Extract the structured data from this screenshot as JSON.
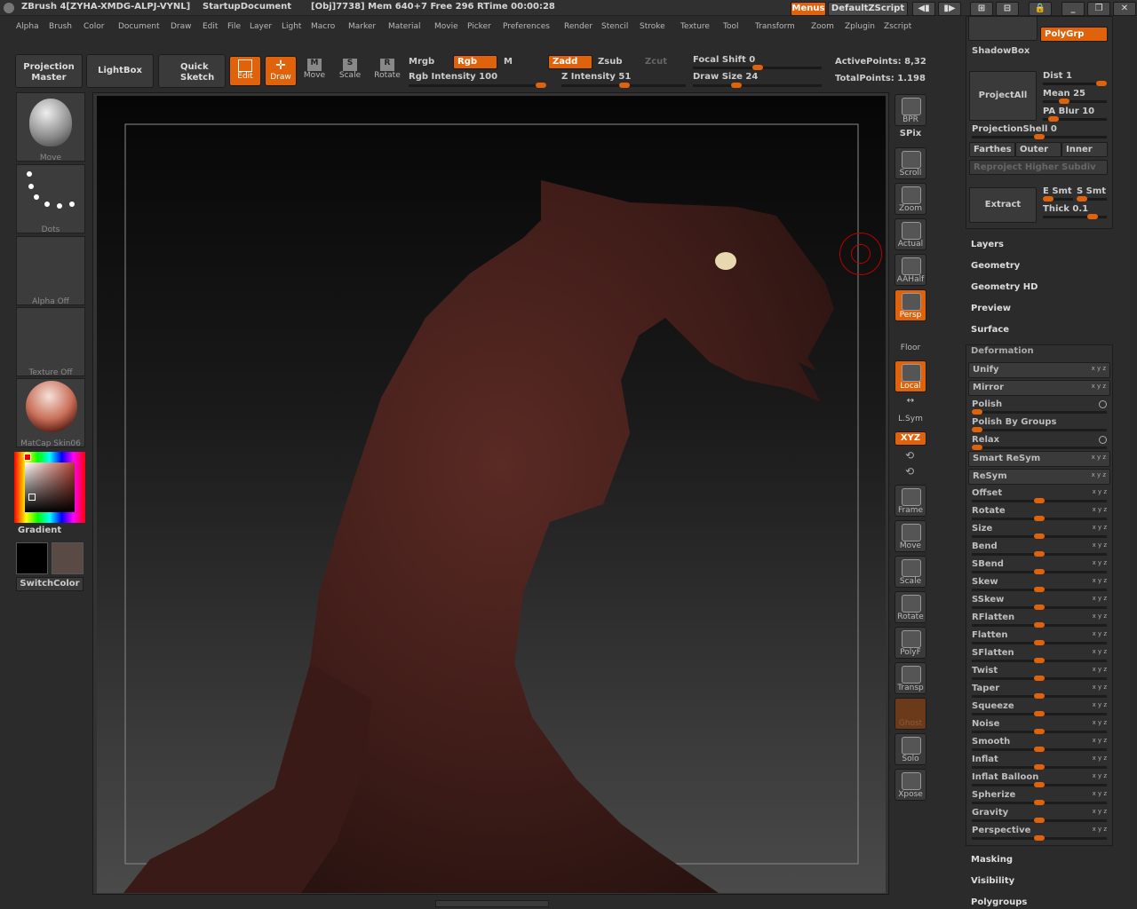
{
  "title": {
    "app": "ZBrush 4[ZYHA-XMDG-ALPJ-VYNL]",
    "document": "StartupDocument",
    "stats": "[Obj]7738] Mem 640+7  Free 296  RTime 00:00:28",
    "menus_btn": "Menus",
    "script_btn": "DefaultZScript"
  },
  "menubar": [
    "Alpha",
    "Brush",
    "Color",
    "Document",
    "Draw",
    "Edit",
    "File",
    "Layer",
    "Light",
    "Macro",
    "Marker",
    "Material",
    "Movie",
    "Picker",
    "Preferences",
    "Render",
    "Stencil",
    "Stroke",
    "Texture",
    "Tool",
    "Transform",
    "Zoom",
    "Zplugin",
    "Zscript"
  ],
  "toolbar": {
    "projection_master": [
      "Projection",
      "Master"
    ],
    "lightbox": "LightBox",
    "quick_sketch": [
      "Quick",
      "Sketch"
    ],
    "edit": "Edit",
    "draw": "Draw",
    "move": "Move",
    "scale": "Scale",
    "rotate": "Rotate",
    "mrgb": "Mrgb",
    "rgb": "Rgb",
    "m": "M",
    "zadd": "Zadd",
    "zsub": "Zsub",
    "zcut": "Zcut",
    "rgb_intensity": "Rgb Intensity 100",
    "z_intensity": "Z Intensity 51",
    "focal_shift": "Focal Shift 0",
    "draw_size": "Draw Size 24",
    "active_points": "ActivePoints: 8,32",
    "total_points": "TotalPoints: 1.198",
    "rgb_intensity_value": 100,
    "z_intensity_value": 51,
    "focal_shift_value": 0,
    "draw_size_value": 24
  },
  "left": {
    "brush": "Move",
    "stroke": "Dots",
    "alpha": "Alpha  Off",
    "texture": "Texture  Off",
    "material": "MatCap  Skin06",
    "gradient": "Gradient",
    "switch_color": "SwitchColor"
  },
  "shelf": [
    "BPR",
    "SPix",
    "Scroll",
    "Zoom",
    "Actual",
    "AAHalf",
    "Persp",
    "Floor",
    "Local",
    "L.Sym",
    "XYZ",
    "Frame",
    "Move",
    "Scale",
    "Rotate",
    "PolyF",
    "Transp",
    "Ghost",
    "Solo",
    "Xpose"
  ],
  "tool": {
    "polygrp": "PolyGrp",
    "shadowbox": "ShadowBox",
    "projectall": "ProjectAll",
    "dist": "Dist 1",
    "mean": "Mean 25",
    "pa_blur": "PA Blur 10",
    "projection_shell": "ProjectionShell 0",
    "farthest": "Farthes",
    "outer": "Outer",
    "inner": "Inner",
    "reproject": "Reproject Higher Subdiv",
    "extract": "Extract",
    "e_smt": "E Smt",
    "s_smt": "S Smt",
    "thick": "Thick 0.1",
    "subpalettes_top": [
      "Layers",
      "Geometry",
      "Geometry HD",
      "Preview",
      "Surface"
    ],
    "deformation_title": "Deformation",
    "deformation": [
      {
        "label": "Unify",
        "xyz": "x y z",
        "framed": true,
        "knob": null
      },
      {
        "label": "Mirror",
        "xyz": "x y z",
        "framed": true,
        "knob": null
      },
      {
        "label": "Polish",
        "xyz": "",
        "framed": false,
        "knob": 0.0
      },
      {
        "label": "Polish By Groups",
        "xyz": "",
        "framed": false,
        "knob": 0.0
      },
      {
        "label": "Relax",
        "xyz": "",
        "framed": false,
        "knob": 0.0
      },
      {
        "label": "Smart ReSym",
        "xyz": "x y z",
        "framed": true,
        "knob": null
      },
      {
        "label": "ReSym",
        "xyz": "x y z",
        "framed": true,
        "knob": null
      },
      {
        "label": "Offset",
        "xyz": "x y z",
        "framed": false,
        "knob": 0.5
      },
      {
        "label": "Rotate",
        "xyz": "x y z",
        "framed": false,
        "knob": 0.5
      },
      {
        "label": "Size",
        "xyz": "x y z",
        "framed": false,
        "knob": 0.5
      },
      {
        "label": "Bend",
        "xyz": "x y z",
        "framed": false,
        "knob": 0.5
      },
      {
        "label": "SBend",
        "xyz": "x y z",
        "framed": false,
        "knob": 0.5
      },
      {
        "label": "Skew",
        "xyz": "x y z",
        "framed": false,
        "knob": 0.5
      },
      {
        "label": "SSkew",
        "xyz": "x y z",
        "framed": false,
        "knob": 0.5
      },
      {
        "label": "RFlatten",
        "xyz": "x y z",
        "framed": false,
        "knob": 0.5
      },
      {
        "label": "Flatten",
        "xyz": "x y z",
        "framed": false,
        "knob": 0.5
      },
      {
        "label": "SFlatten",
        "xyz": "x y z",
        "framed": false,
        "knob": 0.5
      },
      {
        "label": "Twist",
        "xyz": "x y z",
        "framed": false,
        "knob": 0.5
      },
      {
        "label": "Taper",
        "xyz": "x y z",
        "framed": false,
        "knob": 0.5
      },
      {
        "label": "Squeeze",
        "xyz": "x y z",
        "framed": false,
        "knob": 0.5
      },
      {
        "label": "Noise",
        "xyz": "x y z",
        "framed": false,
        "knob": 0.5
      },
      {
        "label": "Smooth",
        "xyz": "x y z",
        "framed": false,
        "knob": 0.5
      },
      {
        "label": "Inflat",
        "xyz": "x y z",
        "framed": false,
        "knob": 0.5
      },
      {
        "label": "Inflat Balloon",
        "xyz": "x y z",
        "framed": false,
        "knob": 0.5
      },
      {
        "label": "Spherize",
        "xyz": "x y z",
        "framed": false,
        "knob": 0.5
      },
      {
        "label": "Gravity",
        "xyz": "x y z",
        "framed": false,
        "knob": 0.5
      },
      {
        "label": "Perspective",
        "xyz": "x y z",
        "framed": false,
        "knob": 0.5
      }
    ],
    "subpalettes_bottom": [
      "Masking",
      "Visibility",
      "Polygroups"
    ]
  },
  "colors": {
    "accent": "#e0620a",
    "model": "#4a2420"
  }
}
